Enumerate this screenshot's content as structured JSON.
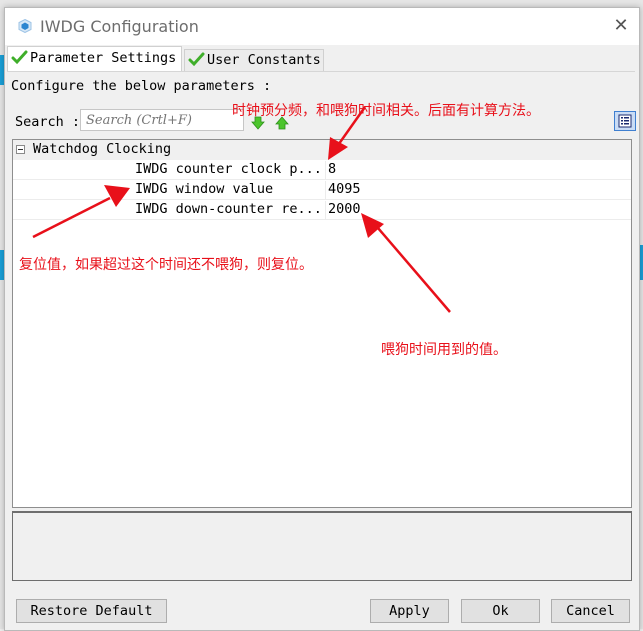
{
  "window": {
    "title": "IWDG Configuration",
    "close_icon": "close-icon"
  },
  "tabs": [
    {
      "label": "Parameter Settings",
      "active": true,
      "icon": "checkmark-icon"
    },
    {
      "label": "User Constants",
      "active": false,
      "icon": "checkmark-icon"
    }
  ],
  "panel": {
    "configure_label": "Configure the below parameters :",
    "search_label": "Search :",
    "search_placeholder": "Search (Crtl+F)",
    "search_value": ""
  },
  "parameters": {
    "group_label": "Watchdog Clocking",
    "rows": [
      {
        "name": "IWDG counter clock p...",
        "value": "8"
      },
      {
        "name": "IWDG window value",
        "value": "4095"
      },
      {
        "name": "IWDG down-counter re...",
        "value": "2000"
      }
    ]
  },
  "buttons": {
    "restore_default": "Restore Default",
    "apply": "Apply",
    "ok": "Ok",
    "cancel": "Cancel"
  },
  "annotations": {
    "prescaler_note": "时钟预分频，和喂狗时间相关。后面有计算方法。",
    "window_note": "复位值，如果超过这个时间还不喂狗，则复位。",
    "reload_note": "喂狗时间用到的值。",
    "color": "#e8101a"
  }
}
